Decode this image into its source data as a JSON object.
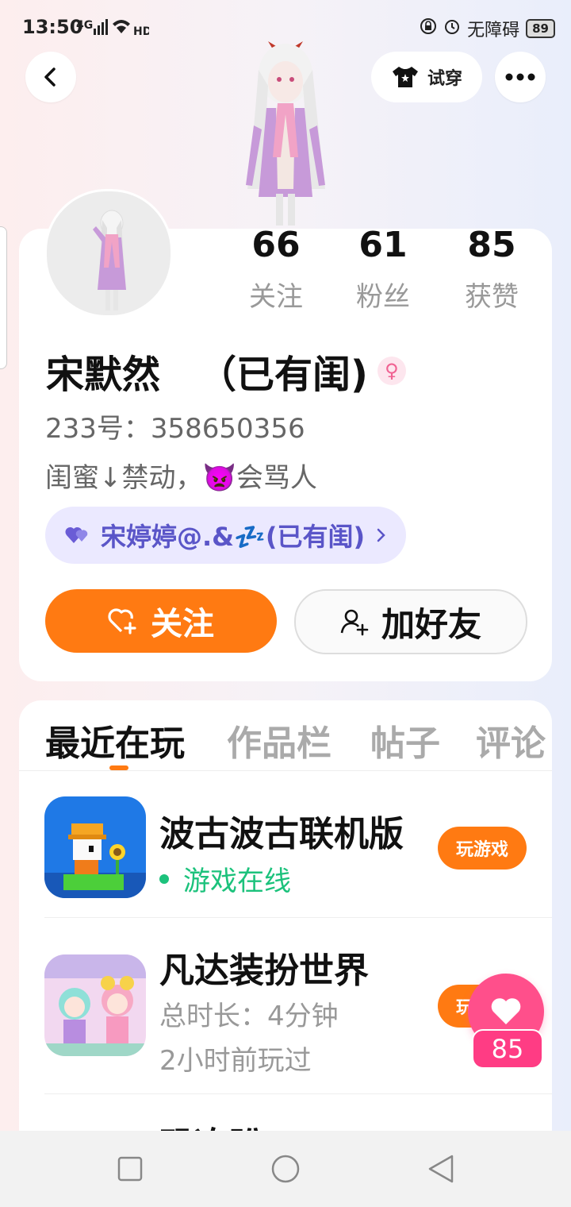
{
  "status_bar": {
    "time": "13:50",
    "network": "4G",
    "accessibility": "无障碍",
    "battery": "89"
  },
  "header": {
    "tryon_label": "试穿"
  },
  "profile": {
    "stats": [
      {
        "value": "66",
        "label": "关注"
      },
      {
        "value": "61",
        "label": "粉丝"
      },
      {
        "value": "85",
        "label": "获赞"
      }
    ],
    "name": "宋默然",
    "name_suffix": "（已有闺)",
    "id_line": "233号：358650356",
    "bio": "闺蜜↓禁动，",
    "bio_emoji": "👿",
    "bio_tail": "会骂人",
    "bff_label": "宋婷婷@.&💤(已有闺)",
    "follow_label": "关注",
    "add_friend_label": "加好友"
  },
  "tabs": [
    {
      "label": "最近在玩",
      "active": true
    },
    {
      "label": "作品栏",
      "active": false
    },
    {
      "label": "帖子",
      "active": false
    },
    {
      "label": "评论",
      "active": false
    }
  ],
  "games": [
    {
      "title": "波古波古联机版",
      "status": "游戏在线",
      "button": "玩游戏"
    },
    {
      "title": "凡达装扮世界",
      "duration": "总时长：4分钟",
      "last_played": "2小时前玩过",
      "button": "玩游戏"
    },
    {
      "title": "恐冻盼"
    }
  ],
  "floating_like": {
    "count": "85"
  },
  "colors": {
    "accent": "#ff7a12",
    "online": "#1cc27c",
    "like": "#ff4f8b",
    "bff": "#5a55c8"
  }
}
